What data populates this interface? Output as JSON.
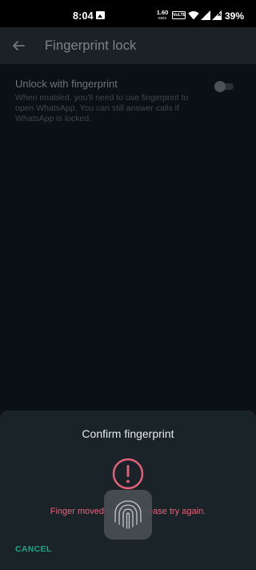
{
  "status_bar": {
    "time": "8:04",
    "net_speed_value": "1.60",
    "net_speed_unit": "KB/S",
    "volte_label": "VoLTE",
    "battery_percent": "39%",
    "icons": [
      "gallery-icon",
      "wifi-icon",
      "signal-icon",
      "battery-icon"
    ]
  },
  "toolbar": {
    "title": "Fingerprint lock",
    "back_icon": "arrow-left-icon"
  },
  "setting": {
    "title": "Unlock with fingerprint",
    "description": "When enabled, you'll need to use fingerprint to open WhatsApp. You can still answer calls if WhatsApp is locked.",
    "toggle_on": false
  },
  "dialog": {
    "title": "Confirm fingerprint",
    "error_message": "Finger moved too fast. Please try again.",
    "cancel_label": "CANCEL",
    "icons": [
      "error-icon",
      "fingerprint-icon"
    ]
  },
  "colors": {
    "background": "#0b1014",
    "toolbar": "#1a2227",
    "dialog": "#1a2328",
    "error": "#e8617b",
    "accent": "#1aa485"
  }
}
